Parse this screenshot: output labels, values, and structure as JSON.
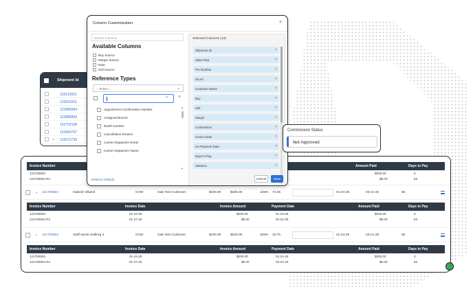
{
  "colors": {
    "accent": "#2f6fd0",
    "header_bg": "#2f3a45",
    "chip_bg": "#d9eaf7",
    "focus": "#3b82f6"
  },
  "shipment_card": {
    "header": "Shipment Id",
    "ids": [
      "123113691",
      "123014331",
      "122985084",
      "122885809",
      "122752108",
      "122683757",
      "122672730"
    ]
  },
  "modal": {
    "title": "Column Customization",
    "search_placeholder": "Search Columns",
    "available_title": "Available Columns",
    "available_options": [
      "Buy Source",
      "Margin Source",
      "Rate",
      "Sell Source"
    ],
    "reference_title": "Reference Types",
    "select_placeholder": "-- Select --",
    "reference_items": [
      "Appointment Confirmation Number",
      "Assigned Branch",
      "Booth Number",
      "Cancellation Reason",
      "Carrier Dispatcher Email",
      "Carrier Dispatcher Name"
    ],
    "selected_title": "Selected Columns (13)",
    "selected_columns": [
      "Shipment ID",
      "Sales Rep",
      "Pro Number",
      "SCAC",
      "Customer Name",
      "Buy",
      "Sell",
      "Margin",
      "Commission",
      "Invoice Date",
      "Inv Payment Date",
      "Days to Pay",
      "Variance"
    ],
    "reset_label": "Reset to Default",
    "cancel_label": "Cancel",
    "save_label": "Save"
  },
  "commission": {
    "label": "Commission Status",
    "value": "Not Approved"
  },
  "grid": {
    "sub_headers": {
      "invoice_number": "Invoice Number",
      "invoice_date": "Invoice Date",
      "invoice_amount": "Invoice Amount",
      "payment_date": "Payment Date",
      "amount_paid": "Amount Paid",
      "days_to_pay": "Days to Pay"
    },
    "top_block": [
      {
        "invoice": "121750504",
        "amount_paid": "$200.00",
        "days": "0"
      },
      {
        "invoice": "121750504 R1",
        "amount_paid": "$5.00",
        "days": "53"
      }
    ],
    "rows": [
      {
        "id": "121750504",
        "rep": "Gabriel Villamil",
        "scac": "GVW",
        "customer": "Gab Test Customer",
        "buy": "$100.00",
        "sell": "$205.00",
        "pct": "105%",
        "margin": "74.25",
        "invoice_date": "01-24-25",
        "payment_date": "03-21-25",
        "days": "56",
        "subrows": [
          {
            "invoice": "121750504",
            "invoice_date": "01-24-25",
            "invoice_amount": "$200.00",
            "payment_date": "01-24-25",
            "amount_paid": "$200.00",
            "days": "0"
          },
          {
            "invoice": "121750504 R1",
            "invoice_date": "01-27-25",
            "invoice_amount": "$5.00",
            "payment_date": "03-21-25",
            "amount_paid": "$5.00",
            "days": "53"
          }
        ]
      },
      {
        "id": "121750504",
        "rep": "Staff-sarah Solberg 2",
        "scac": "GVW",
        "customer": "Gab Test Customer",
        "buy": "$100.00",
        "sell": "$205.00",
        "pct": "105%",
        "margin": "15.75",
        "invoice_date": "01-24-25",
        "payment_date": "03-21-25",
        "days": "56",
        "subrows": [
          {
            "invoice": "121750504",
            "invoice_date": "01-24-25",
            "invoice_amount": "$200.00",
            "payment_date": "01-24-25",
            "amount_paid": "$200.00",
            "days": "0"
          },
          {
            "invoice": "121750504 R1",
            "invoice_date": "01-27-25",
            "invoice_amount": "$5.00",
            "payment_date": "03-21-25",
            "amount_paid": "$5.00",
            "days": "53"
          }
        ]
      }
    ]
  }
}
